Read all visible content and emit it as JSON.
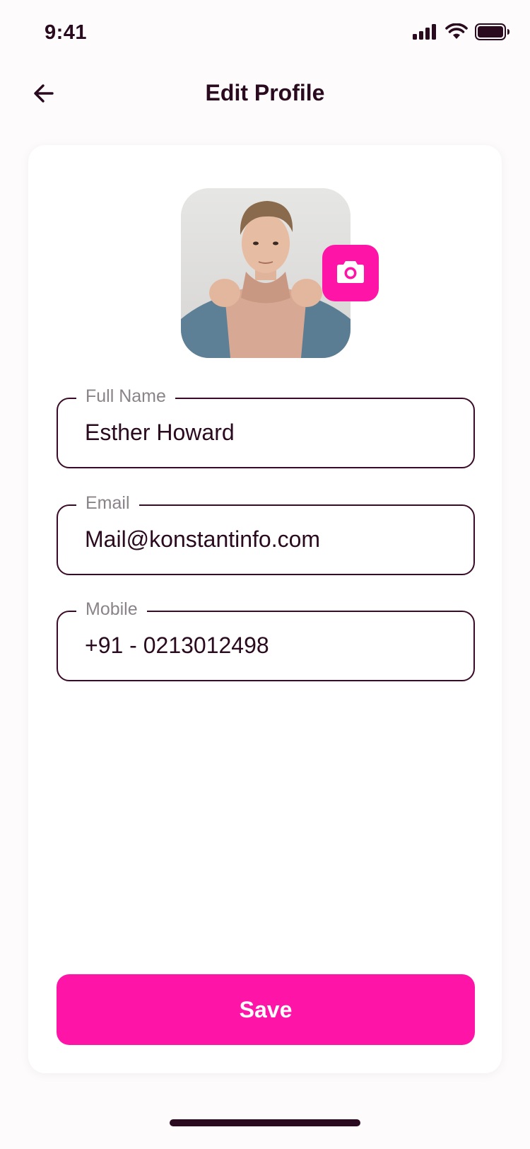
{
  "status_bar": {
    "time": "9:41"
  },
  "header": {
    "title": "Edit Profile",
    "back_icon": "arrow-left-icon"
  },
  "profile": {
    "avatar_icon": "profile-photo",
    "camera_icon": "camera-icon"
  },
  "form": {
    "full_name": {
      "label": "Full Name",
      "value": "Esther Howard"
    },
    "email": {
      "label": "Email",
      "value": "Mail@konstantinfo.com"
    },
    "mobile": {
      "label": "Mobile",
      "value": "+91 - 0213012498"
    }
  },
  "actions": {
    "save_label": "Save"
  },
  "colors": {
    "accent": "#ff14a8",
    "text_dark": "#2a0a1e",
    "label_gray": "#8a8488",
    "background": "#fdfbfc"
  }
}
